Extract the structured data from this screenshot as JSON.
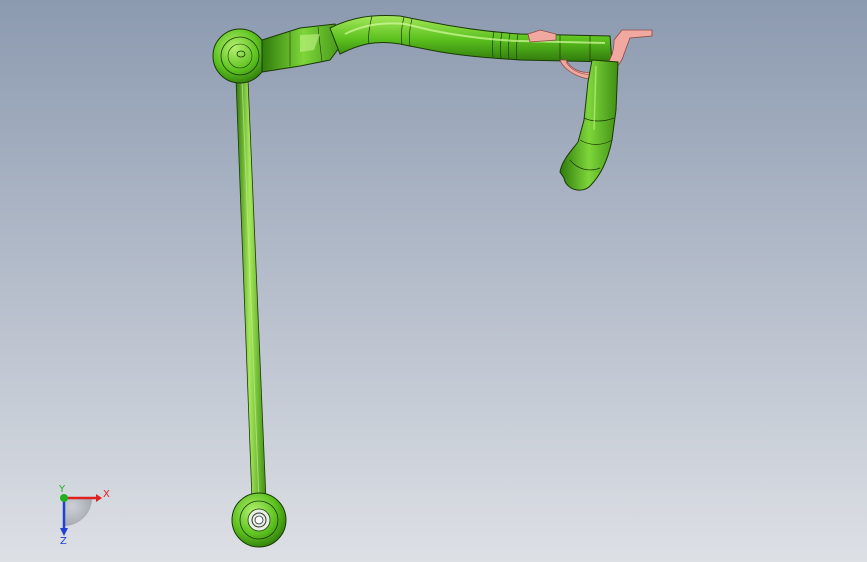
{
  "viewport": {
    "background_top": "#8c9ab0",
    "background_bottom": "#dde0e5"
  },
  "model": {
    "part_color": "#5cc21e",
    "part_shadow": "#2f7a0c",
    "part_highlight": "#a6e85c",
    "edge_color": "#1c3a06",
    "bracket_color": "#f0a8a0",
    "bracket_edge": "#8a4a44"
  },
  "triad": {
    "x_label": "X",
    "y_label": "Y",
    "z_label": "Z",
    "x_color": "#e02020",
    "y_color": "#20b020",
    "z_color": "#2040d0"
  }
}
